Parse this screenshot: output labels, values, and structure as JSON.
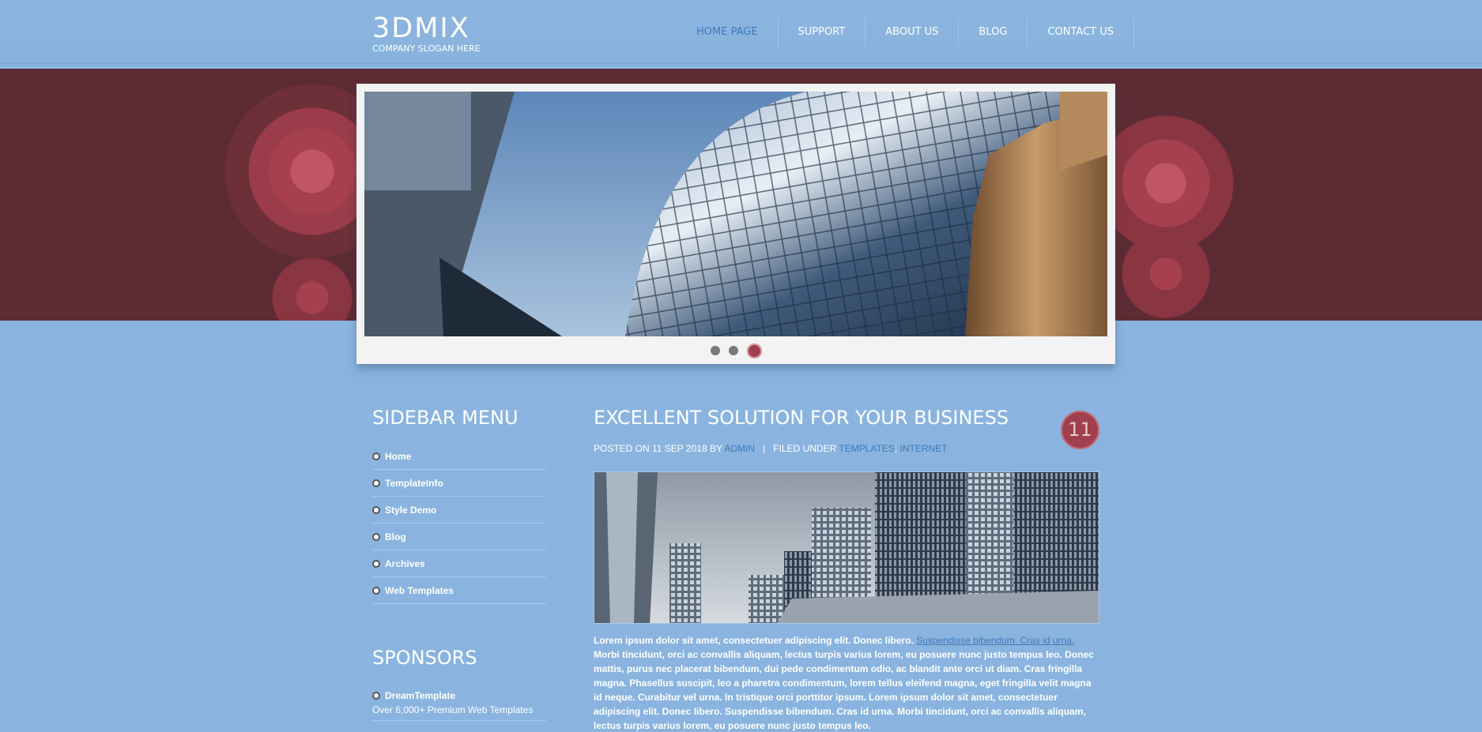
{
  "header": {
    "logo": "3DMIX",
    "slogan": "COMPANY SLOGAN HERE",
    "nav": [
      {
        "label": "HOME PAGE",
        "active": true
      },
      {
        "label": "SUPPORT",
        "active": false
      },
      {
        "label": "ABOUT US",
        "active": false
      },
      {
        "label": "BLOG",
        "active": false
      },
      {
        "label": "CONTACT US",
        "active": false
      }
    ]
  },
  "slider": {
    "slide_count": 3,
    "active_slide": 3
  },
  "sidebar": {
    "menu_heading": "SIDEBAR MENU",
    "menu_items": [
      "Home",
      "TemplateInfo",
      "Style Demo",
      "Blog",
      "Archives",
      "Web Templates"
    ],
    "sponsors_heading": "SPONSORS",
    "sponsors": [
      {
        "name": "DreamTemplate",
        "description": "Over 6,000+ Premium Web Templates"
      }
    ]
  },
  "post": {
    "title": "EXCELLENT SOLUTION FOR YOUR BUSINESS",
    "day": "11",
    "meta_prefix": "POSTED ON 11 SEP 2018 BY",
    "author": "ADMIN",
    "meta_separator": "|",
    "filed_label": "FILED UNDER",
    "categories": [
      "TEMPLATES",
      "INTERNET"
    ],
    "category_sep": ",",
    "text_intro": "Lorem ipsum dolor sit amet, consectetuer adipiscing elit. Donec libero.",
    "text_link": "Suspendisse bibendum. Cras id urna.",
    "text_rest": "Morbi tincidunt, orci ac convallis aliquam, lectus turpis varius lorem, eu posuere nunc justo tempus leo. Donec mattis, purus nec placerat bibendum, dui pede condimentum odio, ac blandit ante orci ut diam. Cras fringilla magna. Phasellus suscipit, leo a pharetra condimentum, lorem tellus eleifend magna, eget fringilla velit magna id neque. Curabitur vel urna. In tristique orci porttitor ipsum. Lorem ipsum dolor sit amet, consectetuer adipiscing elit. Donec libero. Suspendisse bibendum. Cras id urna. Morbi tincidunt, orci ac convallis aliquam, lectus turpis varius lorem, eu posuere nunc justo tempus leo."
  },
  "colors": {
    "background": "#8ab4df",
    "band": "#5d2b33",
    "accent": "#a0404e",
    "link": "#3f78b8"
  }
}
